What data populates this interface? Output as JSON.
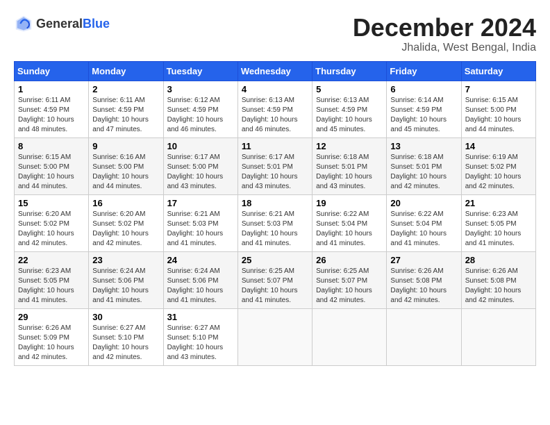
{
  "logo": {
    "text_general": "General",
    "text_blue": "Blue"
  },
  "title": {
    "month": "December 2024",
    "location": "Jhalida, West Bengal, India"
  },
  "calendar": {
    "headers": [
      "Sunday",
      "Monday",
      "Tuesday",
      "Wednesday",
      "Thursday",
      "Friday",
      "Saturday"
    ],
    "weeks": [
      [
        {
          "day": "",
          "info": ""
        },
        {
          "day": "2",
          "info": "Sunrise: 6:11 AM\nSunset: 4:59 PM\nDaylight: 10 hours\nand 47 minutes."
        },
        {
          "day": "3",
          "info": "Sunrise: 6:12 AM\nSunset: 4:59 PM\nDaylight: 10 hours\nand 46 minutes."
        },
        {
          "day": "4",
          "info": "Sunrise: 6:13 AM\nSunset: 4:59 PM\nDaylight: 10 hours\nand 46 minutes."
        },
        {
          "day": "5",
          "info": "Sunrise: 6:13 AM\nSunset: 4:59 PM\nDaylight: 10 hours\nand 45 minutes."
        },
        {
          "day": "6",
          "info": "Sunrise: 6:14 AM\nSunset: 4:59 PM\nDaylight: 10 hours\nand 45 minutes."
        },
        {
          "day": "7",
          "info": "Sunrise: 6:15 AM\nSunset: 5:00 PM\nDaylight: 10 hours\nand 44 minutes."
        }
      ],
      [
        {
          "day": "1",
          "info": "Sunrise: 6:11 AM\nSunset: 4:59 PM\nDaylight: 10 hours\nand 48 minutes."
        },
        {
          "day": "",
          "info": ""
        },
        {
          "day": "",
          "info": ""
        },
        {
          "day": "",
          "info": ""
        },
        {
          "day": "",
          "info": ""
        },
        {
          "day": "",
          "info": ""
        },
        {
          "day": "",
          "info": ""
        }
      ],
      [
        {
          "day": "8",
          "info": "Sunrise: 6:15 AM\nSunset: 5:00 PM\nDaylight: 10 hours\nand 44 minutes."
        },
        {
          "day": "9",
          "info": "Sunrise: 6:16 AM\nSunset: 5:00 PM\nDaylight: 10 hours\nand 44 minutes."
        },
        {
          "day": "10",
          "info": "Sunrise: 6:17 AM\nSunset: 5:00 PM\nDaylight: 10 hours\nand 43 minutes."
        },
        {
          "day": "11",
          "info": "Sunrise: 6:17 AM\nSunset: 5:01 PM\nDaylight: 10 hours\nand 43 minutes."
        },
        {
          "day": "12",
          "info": "Sunrise: 6:18 AM\nSunset: 5:01 PM\nDaylight: 10 hours\nand 43 minutes."
        },
        {
          "day": "13",
          "info": "Sunrise: 6:18 AM\nSunset: 5:01 PM\nDaylight: 10 hours\nand 42 minutes."
        },
        {
          "day": "14",
          "info": "Sunrise: 6:19 AM\nSunset: 5:02 PM\nDaylight: 10 hours\nand 42 minutes."
        }
      ],
      [
        {
          "day": "15",
          "info": "Sunrise: 6:20 AM\nSunset: 5:02 PM\nDaylight: 10 hours\nand 42 minutes."
        },
        {
          "day": "16",
          "info": "Sunrise: 6:20 AM\nSunset: 5:02 PM\nDaylight: 10 hours\nand 42 minutes."
        },
        {
          "day": "17",
          "info": "Sunrise: 6:21 AM\nSunset: 5:03 PM\nDaylight: 10 hours\nand 41 minutes."
        },
        {
          "day": "18",
          "info": "Sunrise: 6:21 AM\nSunset: 5:03 PM\nDaylight: 10 hours\nand 41 minutes."
        },
        {
          "day": "19",
          "info": "Sunrise: 6:22 AM\nSunset: 5:04 PM\nDaylight: 10 hours\nand 41 minutes."
        },
        {
          "day": "20",
          "info": "Sunrise: 6:22 AM\nSunset: 5:04 PM\nDaylight: 10 hours\nand 41 minutes."
        },
        {
          "day": "21",
          "info": "Sunrise: 6:23 AM\nSunset: 5:05 PM\nDaylight: 10 hours\nand 41 minutes."
        }
      ],
      [
        {
          "day": "22",
          "info": "Sunrise: 6:23 AM\nSunset: 5:05 PM\nDaylight: 10 hours\nand 41 minutes."
        },
        {
          "day": "23",
          "info": "Sunrise: 6:24 AM\nSunset: 5:06 PM\nDaylight: 10 hours\nand 41 minutes."
        },
        {
          "day": "24",
          "info": "Sunrise: 6:24 AM\nSunset: 5:06 PM\nDaylight: 10 hours\nand 41 minutes."
        },
        {
          "day": "25",
          "info": "Sunrise: 6:25 AM\nSunset: 5:07 PM\nDaylight: 10 hours\nand 41 minutes."
        },
        {
          "day": "26",
          "info": "Sunrise: 6:25 AM\nSunset: 5:07 PM\nDaylight: 10 hours\nand 42 minutes."
        },
        {
          "day": "27",
          "info": "Sunrise: 6:26 AM\nSunset: 5:08 PM\nDaylight: 10 hours\nand 42 minutes."
        },
        {
          "day": "28",
          "info": "Sunrise: 6:26 AM\nSunset: 5:08 PM\nDaylight: 10 hours\nand 42 minutes."
        }
      ],
      [
        {
          "day": "29",
          "info": "Sunrise: 6:26 AM\nSunset: 5:09 PM\nDaylight: 10 hours\nand 42 minutes."
        },
        {
          "day": "30",
          "info": "Sunrise: 6:27 AM\nSunset: 5:10 PM\nDaylight: 10 hours\nand 42 minutes."
        },
        {
          "day": "31",
          "info": "Sunrise: 6:27 AM\nSunset: 5:10 PM\nDaylight: 10 hours\nand 43 minutes."
        },
        {
          "day": "",
          "info": ""
        },
        {
          "day": "",
          "info": ""
        },
        {
          "day": "",
          "info": ""
        },
        {
          "day": "",
          "info": ""
        }
      ]
    ]
  }
}
